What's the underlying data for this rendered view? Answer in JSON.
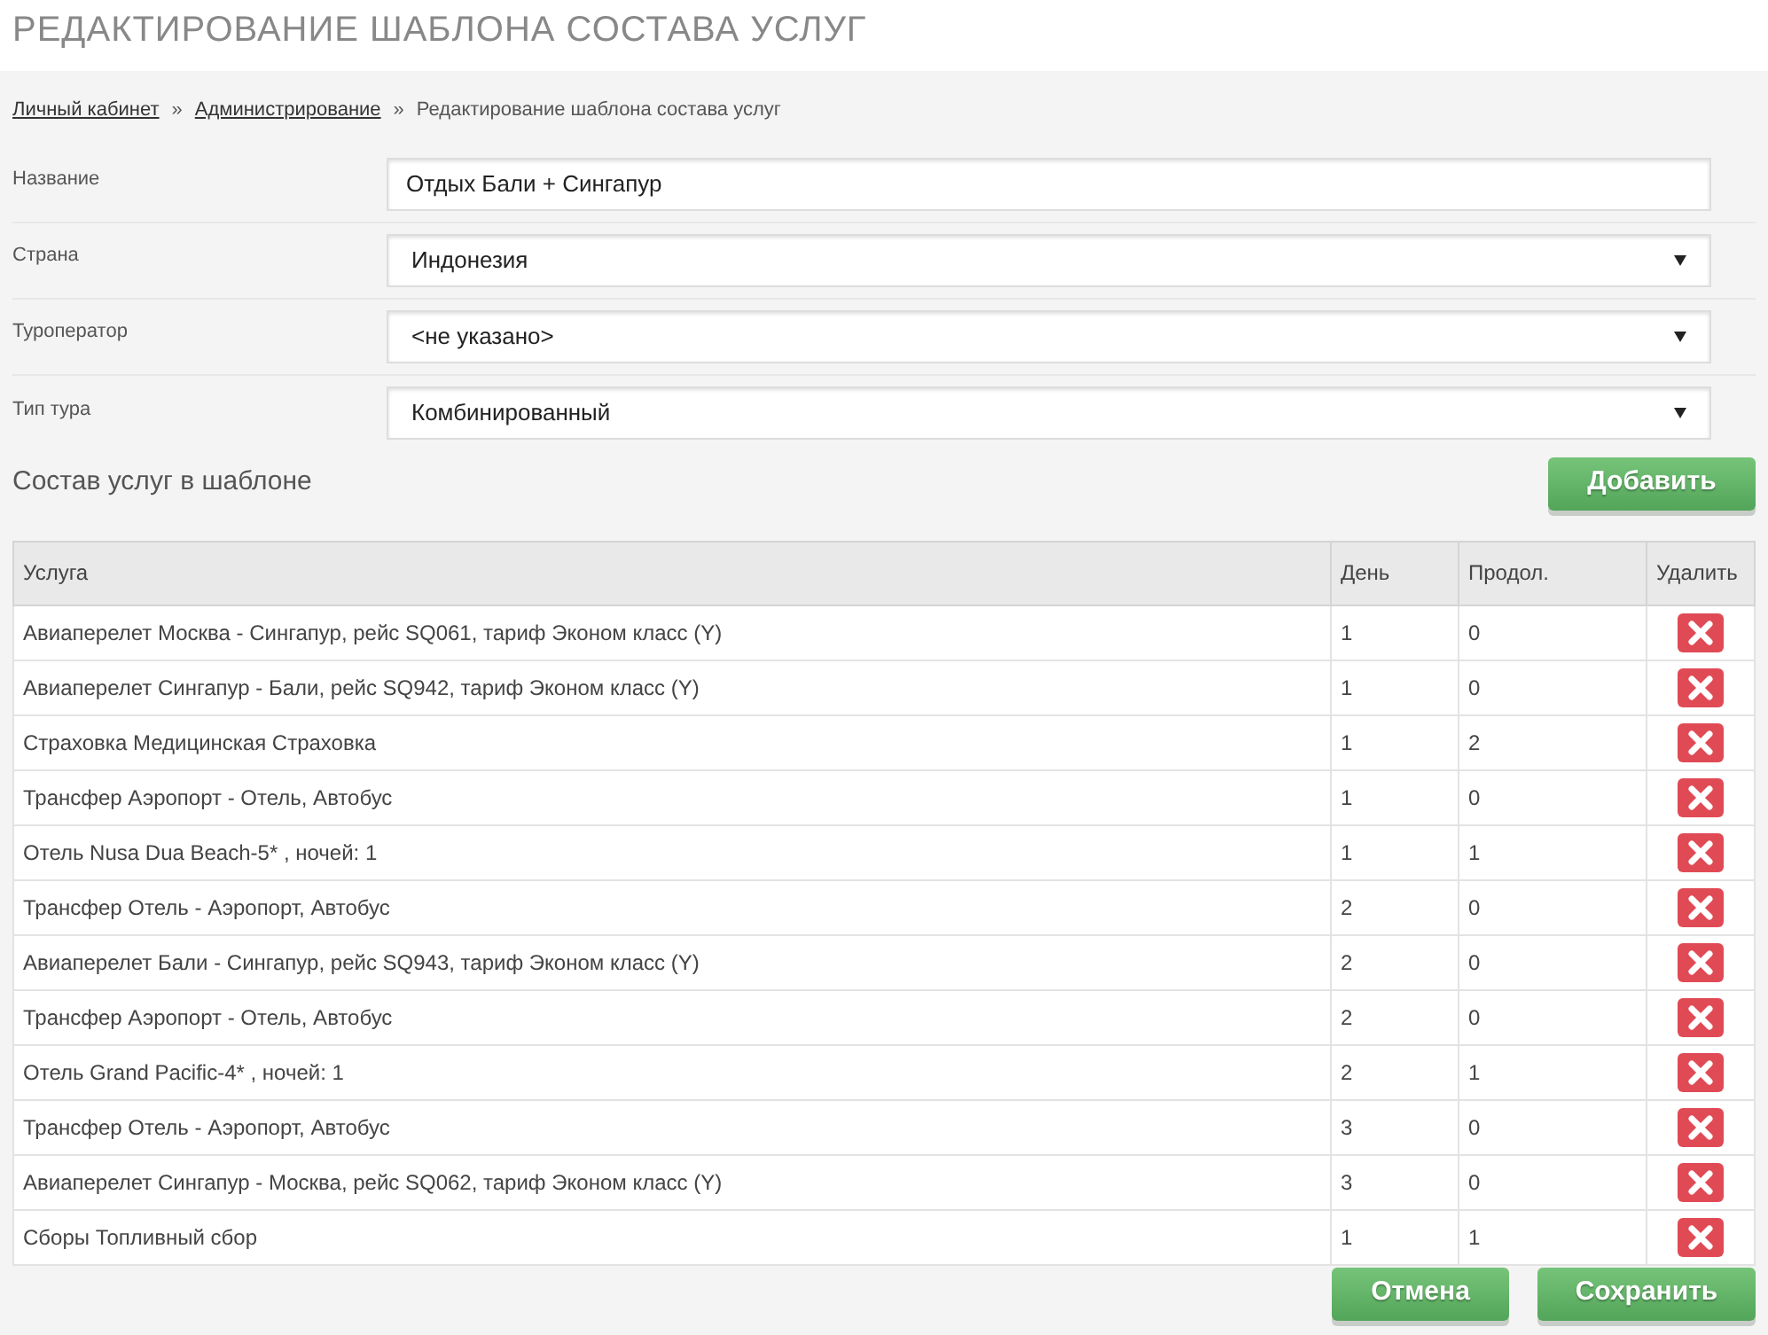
{
  "page_title": "РЕДАКТИРОВАНИЕ ШАБЛОНА СОСТАВА УСЛУГ",
  "breadcrumbs": [
    {
      "label": "Личный кабинет",
      "kind": "link"
    },
    {
      "separator": "»",
      "label": "Администрирование",
      "kind": "link"
    },
    {
      "separator": "»",
      "label": "Редактирование шаблона состава услуг",
      "kind": "current"
    }
  ],
  "form": [
    {
      "label": "Название",
      "kind": "text",
      "value": "Отдых Бали + Сингапур"
    },
    {
      "label": "Страна",
      "kind": "select",
      "value": "Индонезия"
    },
    {
      "label": "Туроператор",
      "kind": "select",
      "value": "<не указано>"
    },
    {
      "label": "Тип тура",
      "kind": "select",
      "value": "Комбинированный"
    }
  ],
  "section_title": "Состав услуг в шаблоне",
  "add_button": "Добавить",
  "table": {
    "columns": [
      "Услуга",
      "День",
      "Продол.",
      "Удалить"
    ],
    "rows": [
      [
        "Авиаперелет Москва - Сингапур, рейс SQ061, тариф Эконом класс (Y)",
        "1",
        "0"
      ],
      [
        "Авиаперелет Сингапур - Бали, рейс SQ942, тариф Эконом класс (Y)",
        "1",
        "0"
      ],
      [
        "Страховка Медицинская Страховка",
        "1",
        "2"
      ],
      [
        "Трансфер Аэропорт - Отель, Автобус",
        "1",
        "0"
      ],
      [
        "Отель Nusa Dua Beach-5* , ночей: 1",
        "1",
        "1"
      ],
      [
        "Трансфер Отель - Аэропорт, Автобус",
        "2",
        "0"
      ],
      [
        "Авиаперелет Бали - Сингапур, рейс SQ943, тариф Эконом класс (Y)",
        "2",
        "0"
      ],
      [
        "Трансфер Аэропорт - Отель, Автобус",
        "2",
        "0"
      ],
      [
        "Отель Grand Pacific-4* , ночей: 1",
        "2",
        "1"
      ],
      [
        "Трансфер Отель - Аэропорт, Автобус",
        "3",
        "0"
      ],
      [
        "Авиаперелет Сингапур - Москва, рейс SQ062, тариф Эконом класс (Y)",
        "3",
        "0"
      ],
      [
        "Сборы Топливный сбор",
        "1",
        "1"
      ]
    ]
  },
  "buttons": [
    "Отмена",
    "Сохранить"
  ]
}
